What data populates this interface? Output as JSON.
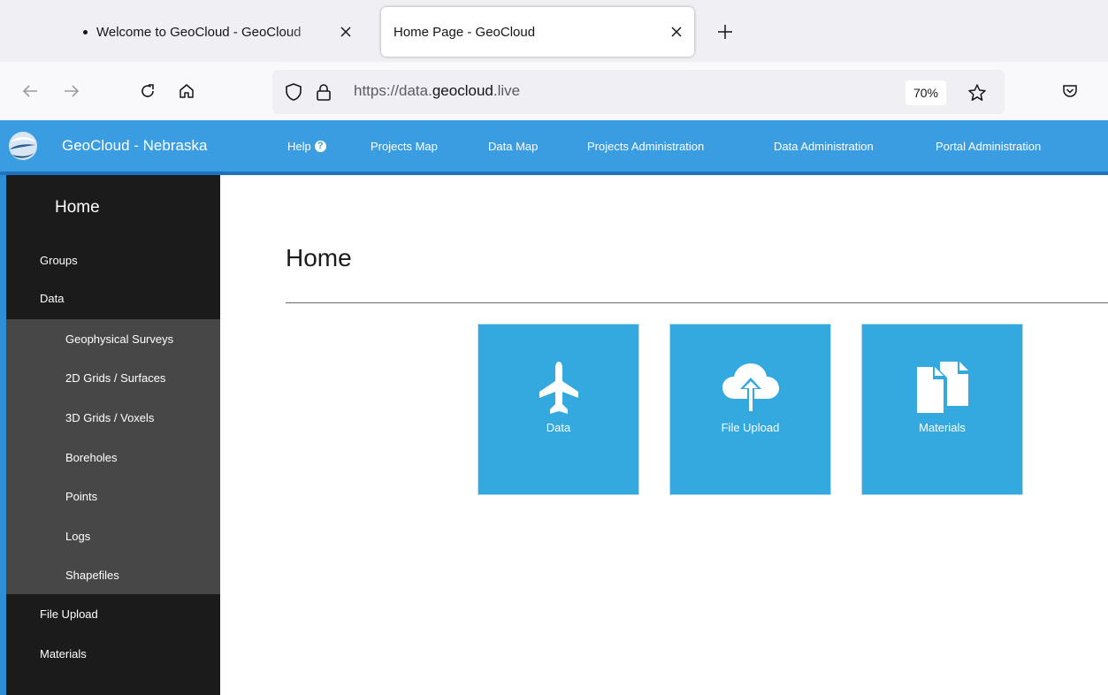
{
  "browser": {
    "tabs": [
      {
        "title": "Welcome to GeoCloud - GeoCloud",
        "active": false
      },
      {
        "title": "Home Page - GeoCloud",
        "active": true
      }
    ],
    "url": {
      "scheme": "https://data.",
      "host": "geocloud",
      "tld": ".live"
    },
    "zoom": "70%"
  },
  "app": {
    "title": "GeoCloud - Nebraska",
    "menu": [
      {
        "label": "Help"
      },
      {
        "label": "Projects Map"
      },
      {
        "label": "Data Map"
      },
      {
        "label": "Projects Administration"
      },
      {
        "label": "Data Administration"
      },
      {
        "label": "Portal Administration"
      }
    ],
    "help_badge": "?"
  },
  "sidebar": {
    "title": "Home",
    "items": [
      {
        "label": "Groups"
      },
      {
        "label": "Data"
      },
      {
        "label": "File Upload"
      },
      {
        "label": "Materials"
      }
    ],
    "data_children": [
      {
        "label": "Geophysical Surveys"
      },
      {
        "label": "2D Grids / Surfaces"
      },
      {
        "label": "3D Grids / Voxels"
      },
      {
        "label": "Boreholes"
      },
      {
        "label": "Points"
      },
      {
        "label": "Logs"
      },
      {
        "label": "Shapefiles"
      }
    ]
  },
  "main": {
    "title": "Home",
    "tiles": [
      {
        "label": "Data",
        "icon": "plane-icon"
      },
      {
        "label": "File Upload",
        "icon": "cloud-upload-icon"
      },
      {
        "label": "Materials",
        "icon": "files-icon"
      }
    ]
  },
  "colors": {
    "header_blue": "#3a9de1",
    "tile_blue": "#33a9e0",
    "sidebar_dark": "#1b1b1b",
    "submenu_gray": "#474747"
  }
}
